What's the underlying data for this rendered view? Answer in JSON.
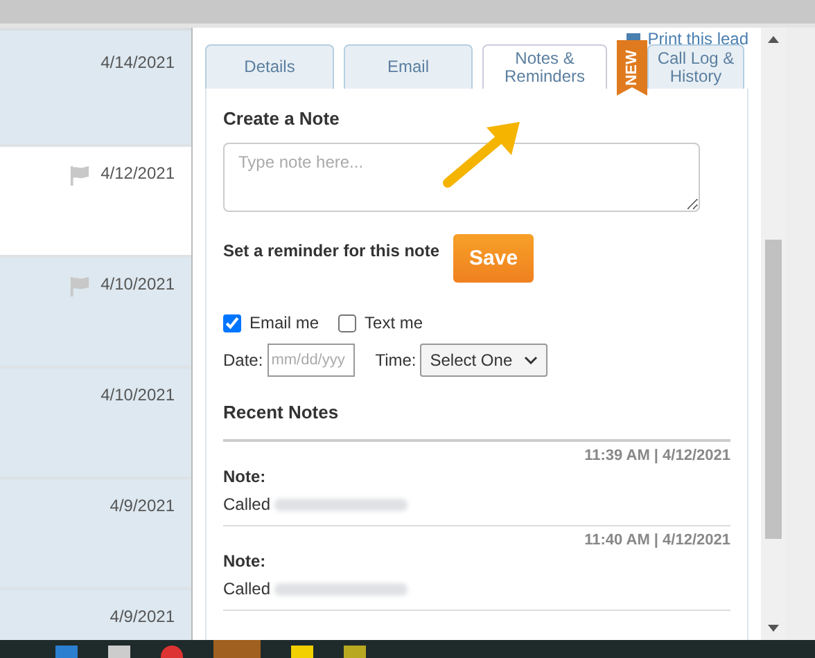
{
  "lead_list": [
    {
      "date": "4/14/2021",
      "highlighted": true,
      "flagged": false
    },
    {
      "date": "4/12/2021",
      "highlighted": false,
      "flagged": true
    },
    {
      "date": "4/10/2021",
      "highlighted": true,
      "flagged": true
    },
    {
      "date": "4/10/2021",
      "highlighted": true,
      "flagged": false
    },
    {
      "date": "4/9/2021",
      "highlighted": true,
      "flagged": false
    },
    {
      "date": "4/9/2021",
      "highlighted": true,
      "flagged": false
    }
  ],
  "print_link": "Print this lead",
  "tabs": [
    {
      "label": "Details",
      "selected": false
    },
    {
      "label": "Email",
      "selected": false
    },
    {
      "label": "Notes & Reminders",
      "selected": true
    },
    {
      "label": "Call Log & History",
      "selected": false,
      "badge": "NEW"
    }
  ],
  "create_note": {
    "heading": "Create a Note",
    "placeholder": "Type note here...",
    "reminder_label": "Set a reminder for this note",
    "save_button": "Save",
    "options": [
      {
        "label": "Email me",
        "checked": true
      },
      {
        "label": "Text me",
        "checked": false
      }
    ],
    "date_label": "Date:",
    "date_placeholder": "mm/dd/yyy",
    "time_label": "Time:",
    "time_value": "Select One"
  },
  "recent_notes": {
    "heading": "Recent Notes",
    "notes": [
      {
        "timestamp": "11:39 AM | 4/12/2021",
        "label": "Note:",
        "text": "Called"
      },
      {
        "timestamp": "11:40 AM | 4/12/2021",
        "label": "Note:",
        "text": "Called"
      }
    ]
  }
}
